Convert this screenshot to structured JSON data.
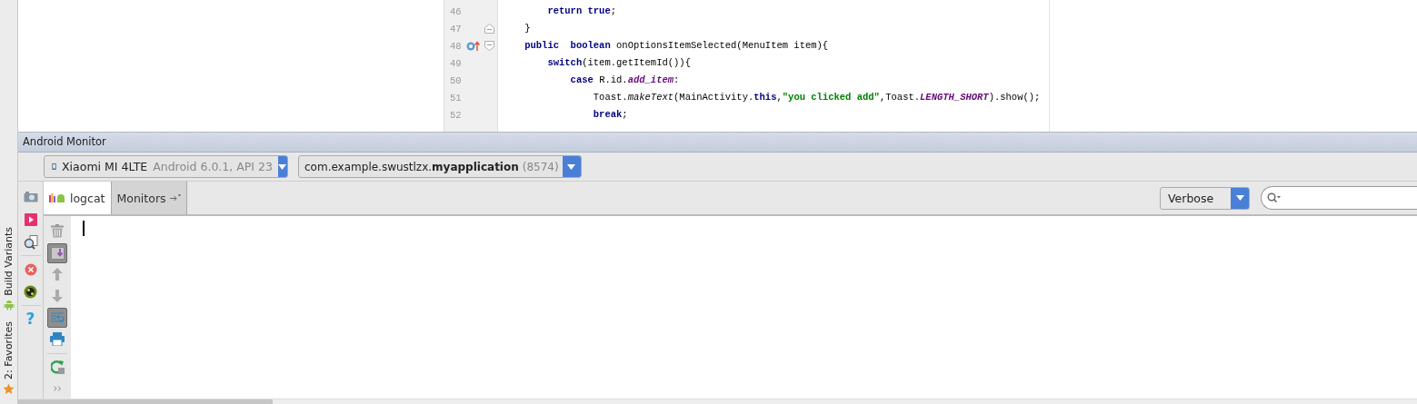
{
  "editor": {
    "lines": [
      {
        "number": "46",
        "fold_start": false,
        "fold_end": false,
        "override_marker": false,
        "tokens": [
          {
            "kind": "keyword",
            "text": "        return true"
          },
          {
            "kind": "plain",
            "text": ";"
          }
        ]
      },
      {
        "number": "47",
        "fold_start": false,
        "fold_end": true,
        "override_marker": false,
        "tokens": [
          {
            "kind": "plain",
            "text": "    }"
          }
        ]
      },
      {
        "number": "48",
        "fold_start": true,
        "fold_end": false,
        "override_marker": true,
        "tokens": [
          {
            "kind": "keyword",
            "text": "    public  boolean"
          },
          {
            "kind": "plain",
            "text": " onOptionsItemSelected(MenuItem item){"
          }
        ]
      },
      {
        "number": "49",
        "fold_start": false,
        "fold_end": false,
        "override_marker": false,
        "tokens": [
          {
            "kind": "keyword",
            "text": "        switch"
          },
          {
            "kind": "plain",
            "text": "(item.getItemId()){"
          }
        ]
      },
      {
        "number": "50",
        "fold_start": false,
        "fold_end": false,
        "override_marker": false,
        "tokens": [
          {
            "kind": "keyword",
            "text": "            case"
          },
          {
            "kind": "plain",
            "text": " R.id."
          },
          {
            "kind": "field",
            "text": "add_item"
          },
          {
            "kind": "plain",
            "text": ":"
          }
        ]
      },
      {
        "number": "51",
        "fold_start": false,
        "fold_end": false,
        "override_marker": false,
        "tokens": [
          {
            "kind": "plain",
            "text": "                Toast."
          },
          {
            "kind": "method",
            "text": "makeText"
          },
          {
            "kind": "plain",
            "text": "(MainActivity."
          },
          {
            "kind": "keyword",
            "text": "this"
          },
          {
            "kind": "plain",
            "text": ","
          },
          {
            "kind": "string",
            "text": "\"you clicked add\""
          },
          {
            "kind": "plain",
            "text": ",Toast."
          },
          {
            "kind": "field",
            "text": "LENGTH_SHORT"
          },
          {
            "kind": "plain",
            "text": ").show();"
          }
        ]
      },
      {
        "number": "52",
        "fold_start": false,
        "fold_end": false,
        "override_marker": false,
        "tokens": [
          {
            "kind": "keyword",
            "text": "                break"
          },
          {
            "kind": "plain",
            "text": ";"
          }
        ]
      }
    ]
  },
  "side_strip": [
    {
      "kind": "android",
      "label": "Build Variants"
    },
    {
      "kind": "star",
      "label": "2: Favorites"
    }
  ],
  "monitor": {
    "title": "Android Monitor",
    "device": {
      "name": "Xiaomi MI 4LTE",
      "detail": "Android 6.0.1, API 23"
    },
    "process": {
      "name": "com.example.swustlzx.**myapplication**",
      "pid": "(8574)"
    },
    "tabs": [
      {
        "label": "logcat",
        "kind": "logcat",
        "selected": true
      },
      {
        "label": "Monitors",
        "kind": "monitors",
        "selected": false
      }
    ],
    "log_level": "Verbose",
    "left_tools": [
      {
        "kind": "camera"
      },
      {
        "kind": "record"
      },
      {
        "kind": "screen-capture"
      },
      {
        "kind": "divider"
      },
      {
        "kind": "close"
      },
      {
        "kind": "terminate"
      },
      {
        "kind": "divider"
      },
      {
        "kind": "help",
        "glyph": "?"
      }
    ],
    "log_tools": [
      {
        "kind": "trash",
        "pressed": false
      },
      {
        "kind": "scroll-end",
        "pressed": true
      },
      {
        "kind": "up",
        "pressed": false
      },
      {
        "kind": "down",
        "pressed": false
      },
      {
        "kind": "wrap",
        "pressed": true
      },
      {
        "kind": "print",
        "pressed": false
      },
      {
        "kind": "divider"
      },
      {
        "kind": "restart",
        "pressed": false
      },
      {
        "kind": "more",
        "pressed": false
      }
    ]
  }
}
